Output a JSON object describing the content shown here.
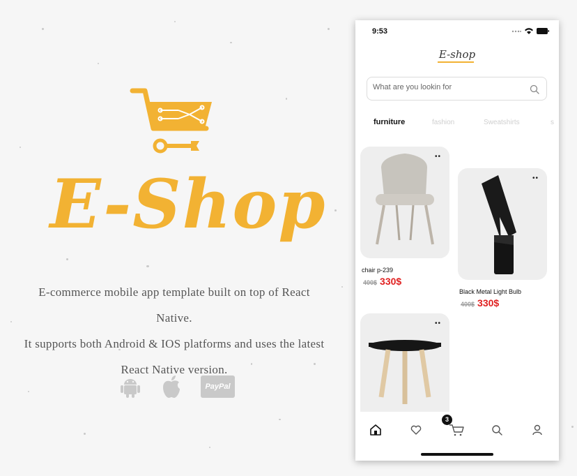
{
  "promo": {
    "brand_title": "E-Shop",
    "tagline_lines": [
      "E-commerce mobile app template built on top of React Native.",
      "It supports both Android & IOS platforms and uses the latest",
      "React Native version."
    ],
    "platform_icons": [
      "android-icon",
      "apple-icon",
      "paypal-icon"
    ],
    "paypal_label": "PayPal"
  },
  "phone": {
    "status_time": "9:53",
    "app_title": "E-shop",
    "search": {
      "placeholder": "What are you lookin for",
      "value": ""
    },
    "tabs": [
      {
        "label": "furniture",
        "active": true
      },
      {
        "label": "fashion",
        "active": false
      },
      {
        "label": "Sweatshirts",
        "active": false
      },
      {
        "label": "s",
        "active": false
      }
    ],
    "products": [
      {
        "name": "chair p-239",
        "old_price": "400$",
        "new_price": "330$",
        "image": "chair-image"
      },
      {
        "name": "Black Metal Light Bulb",
        "old_price": "400$",
        "new_price": "330$",
        "image": "lamp-image"
      },
      {
        "name": "",
        "old_price": "",
        "new_price": "",
        "image": "side-table-image"
      }
    ],
    "card_menu": "••",
    "nav": {
      "cart_badge": "3",
      "items": [
        "home-icon",
        "heart-icon",
        "cart-icon",
        "search-icon",
        "profile-icon"
      ]
    }
  },
  "colors": {
    "accent": "#f2b233",
    "price": "#e02020",
    "tab_inactive": "#cfcfcf"
  }
}
